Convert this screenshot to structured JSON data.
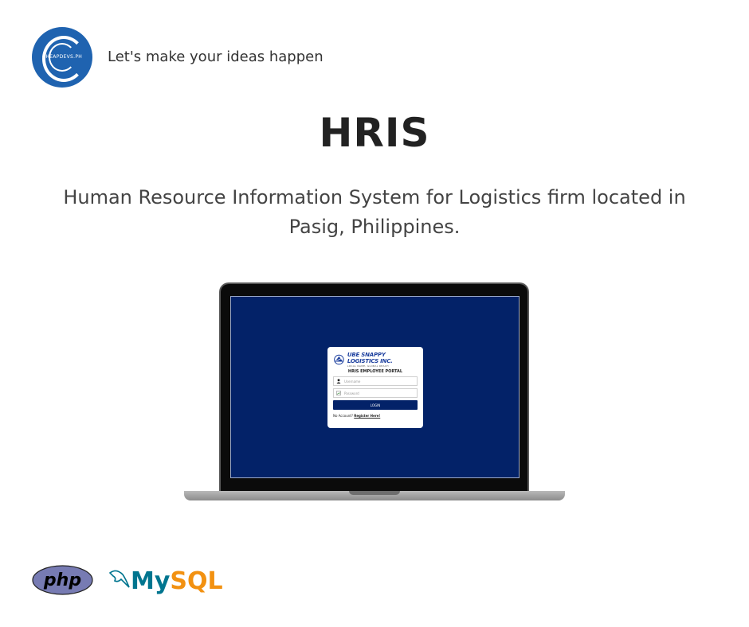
{
  "header": {
    "logo_text": "CHEAPDEVS.PH",
    "tagline": "Let's make your ideas happen"
  },
  "project": {
    "title": "HRIS",
    "description": "Human Resource Information System for Logistics firm located in Pasig, Philippines."
  },
  "login_screen": {
    "company_name": "UBE SNAPPY LOGISTICS INC.",
    "company_motto": "LOCAL NAME, GLOBAL REACH",
    "portal_title": "HRIS EMPLOYEE PORTAL",
    "username_placeholder": "Username",
    "password_placeholder": "Password",
    "login_label": "LOGIN",
    "no_account_text": "No Account?",
    "register_label": "Register Here!",
    "colors": {
      "screen_bg": "#032268",
      "button_bg": "#032268"
    }
  },
  "tech_stack": {
    "php_label": "php",
    "mysql_label": "MySQL"
  },
  "colors": {
    "brand_blue": "#1f63b0",
    "php_purple": "#777bb3",
    "mysql_blue": "#00758f",
    "mysql_orange": "#f29111"
  }
}
